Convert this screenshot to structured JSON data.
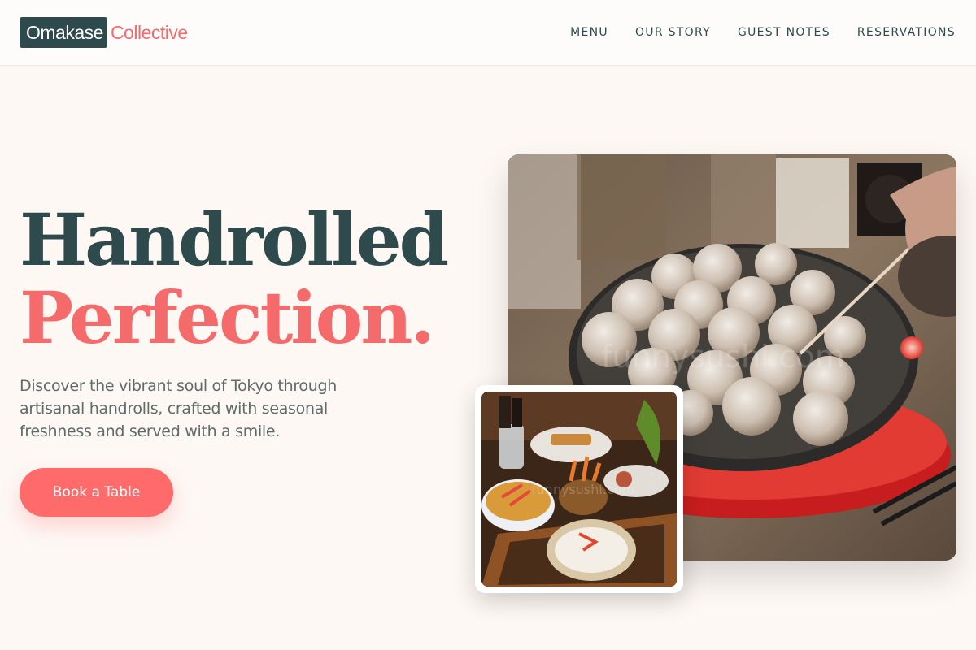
{
  "brand": {
    "name_part1": "Omakase",
    "name_part2": "Collective",
    "primary_color": "#2f4a4c",
    "accent_color": "#ff6b6b"
  },
  "nav": {
    "items": [
      {
        "label": "MENU"
      },
      {
        "label": "OUR STORY"
      },
      {
        "label": "GUEST NOTES"
      },
      {
        "label": "RESERVATIONS"
      }
    ]
  },
  "hero": {
    "title_line1": "Handrolled",
    "title_line2": "Perfection.",
    "description": "Discover the vibrant soul of Tokyo through artisanal handrolls, crafted with seasonal freshness and served with a smile.",
    "cta_label": "Book a Table"
  },
  "images": {
    "main": {
      "watermark": "funnysushi.com"
    },
    "inset": {
      "watermark": "funnysushi.com"
    }
  }
}
